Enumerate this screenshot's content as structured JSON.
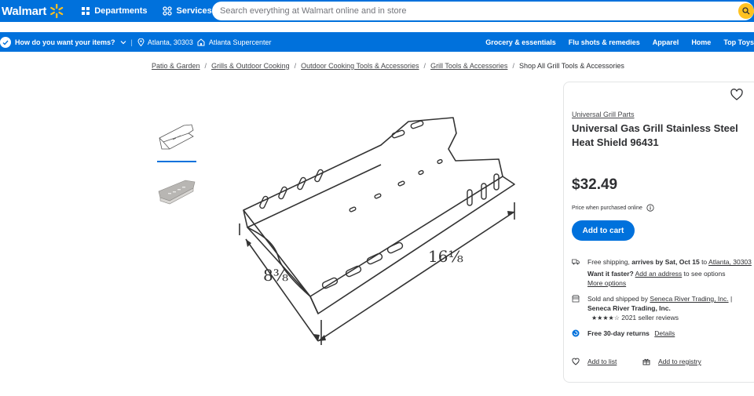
{
  "header": {
    "logo_text": "Walmart",
    "departments_label": "Departments",
    "services_label": "Services",
    "search_placeholder": "Search everything at Walmart online and in store",
    "brand_color": "#0071dc",
    "accent_color": "#ffc220"
  },
  "subheader": {
    "fulfillment_label": "How do you want your items?",
    "location": "Atlanta, 30303",
    "store": "Atlanta Supercenter",
    "nav": [
      "Grocery & essentials",
      "Flu shots & remedies",
      "Apparel",
      "Home",
      "Top Toys"
    ]
  },
  "breadcrumb": {
    "items": [
      "Patio & Garden",
      "Grills & Outdoor Cooking",
      "Outdoor Cooking Tools & Accessories",
      "Grill Tools & Accessories"
    ],
    "current": "Shop All Grill Tools & Accessories"
  },
  "image": {
    "dim_width": "8⅜",
    "dim_length": "16⅛"
  },
  "product": {
    "brand": "Universal Grill Parts",
    "title": "Universal Gas Grill Stainless Steel Heat Shield 96431",
    "price": "$32.49",
    "price_note": "Price when purchased online",
    "add_to_cart": "Add to cart"
  },
  "shipping": {
    "prefix": "Free shipping, ",
    "arrives": "arrives by Sat, Oct 15",
    "to": " to ",
    "location": "Atlanta, 30303",
    "faster_label": "Want it faster?",
    "add_address": "Add an address",
    "see_options": " to see options",
    "more_options": "More options"
  },
  "seller": {
    "prefix": "Sold and shipped by ",
    "name_link": "Seneca River Trading, Inc.",
    "pipe": " |",
    "name_bold": "Seneca River Trading, Inc.",
    "stars": "★★★★☆",
    "reviews": "2021 seller reviews"
  },
  "returns": {
    "label": "Free 30-day returns",
    "details": "Details"
  },
  "actions": {
    "add_to_list": "Add to list",
    "add_to_registry": "Add to registry"
  }
}
